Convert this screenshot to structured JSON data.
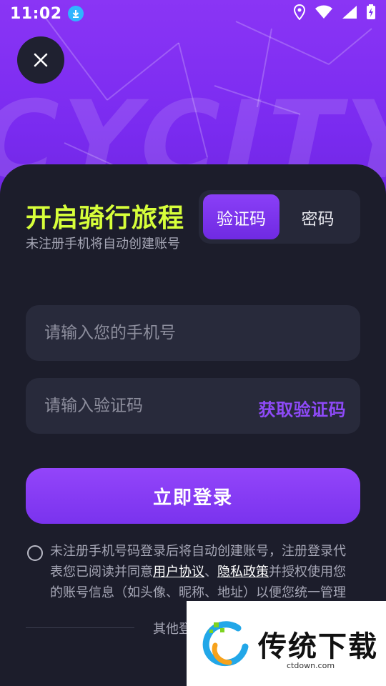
{
  "status_bar": {
    "time": "11:02"
  },
  "hero": {
    "brand": "CYCITY"
  },
  "panel": {
    "title": "开启骑行旅程",
    "subtitle": "未注册手机将自动创建账号",
    "tabs": [
      {
        "label": "验证码",
        "active": true
      },
      {
        "label": "密码",
        "active": false
      }
    ],
    "phone_placeholder": "请输入您的手机号",
    "code_placeholder": "请输入验证码",
    "get_code_label": "获取验证码",
    "login_label": "立即登录",
    "agreement": {
      "prefix": "未注册手机号码登录后将自动创建账号，注册登录代表您已阅读并同意",
      "user_agreement": "用户协议",
      "sep": "、",
      "privacy_policy": "隐私政策",
      "suffix": "并授权使用您的账号信息（如头像、昵称、地址）以便您统一管理"
    },
    "other_login": "其他登"
  },
  "watermark": {
    "name": "传统下载",
    "url": "ctdown.com"
  },
  "colors": {
    "accent": "#7a2ef0",
    "title": "#d7ff3a",
    "panel_bg": "#1c1d2b",
    "field_bg": "#282a3b"
  }
}
